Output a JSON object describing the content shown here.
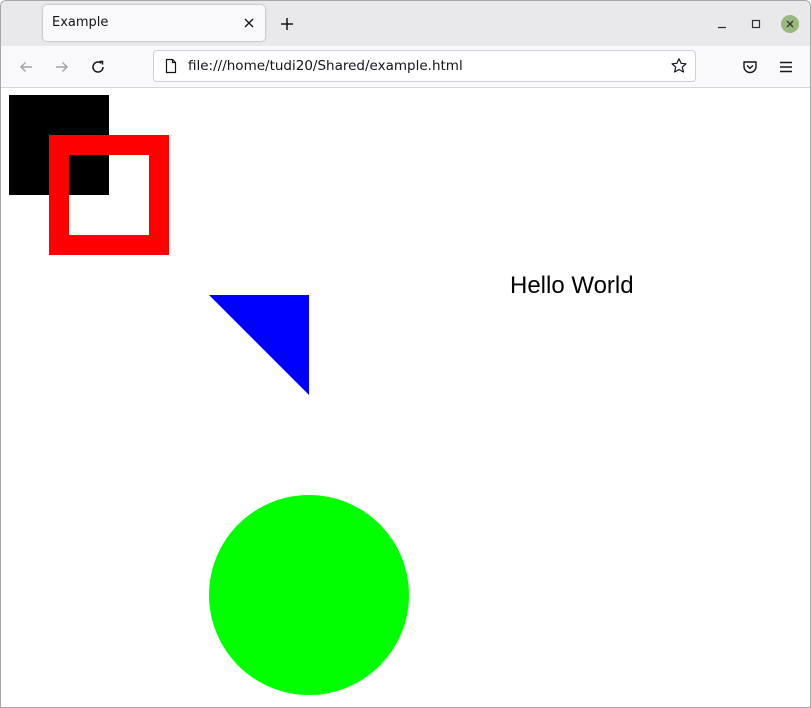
{
  "tab": {
    "title": "Example",
    "close_icon": "close-icon",
    "new_tab_icon": "plus-icon"
  },
  "window_controls": {
    "minimize_icon": "minimize-icon",
    "maximize_icon": "maximize-icon",
    "close_icon": "close-icon",
    "close_color": "#9ab87c"
  },
  "navbar": {
    "back_icon": "arrow-left-icon",
    "forward_icon": "arrow-right-icon",
    "reload_icon": "reload-icon",
    "url": "file:///home/tudi20/Shared/example.html",
    "page_icon": "page-icon",
    "bookmark_icon": "star-icon",
    "pocket_icon": "pocket-icon",
    "menu_icon": "hamburger-menu-icon"
  },
  "content": {
    "text": "Hello World",
    "colors": {
      "square": "#000000",
      "outlined_square": "#ff0000",
      "triangle": "#0000ff",
      "circle": "#00ff00"
    }
  }
}
